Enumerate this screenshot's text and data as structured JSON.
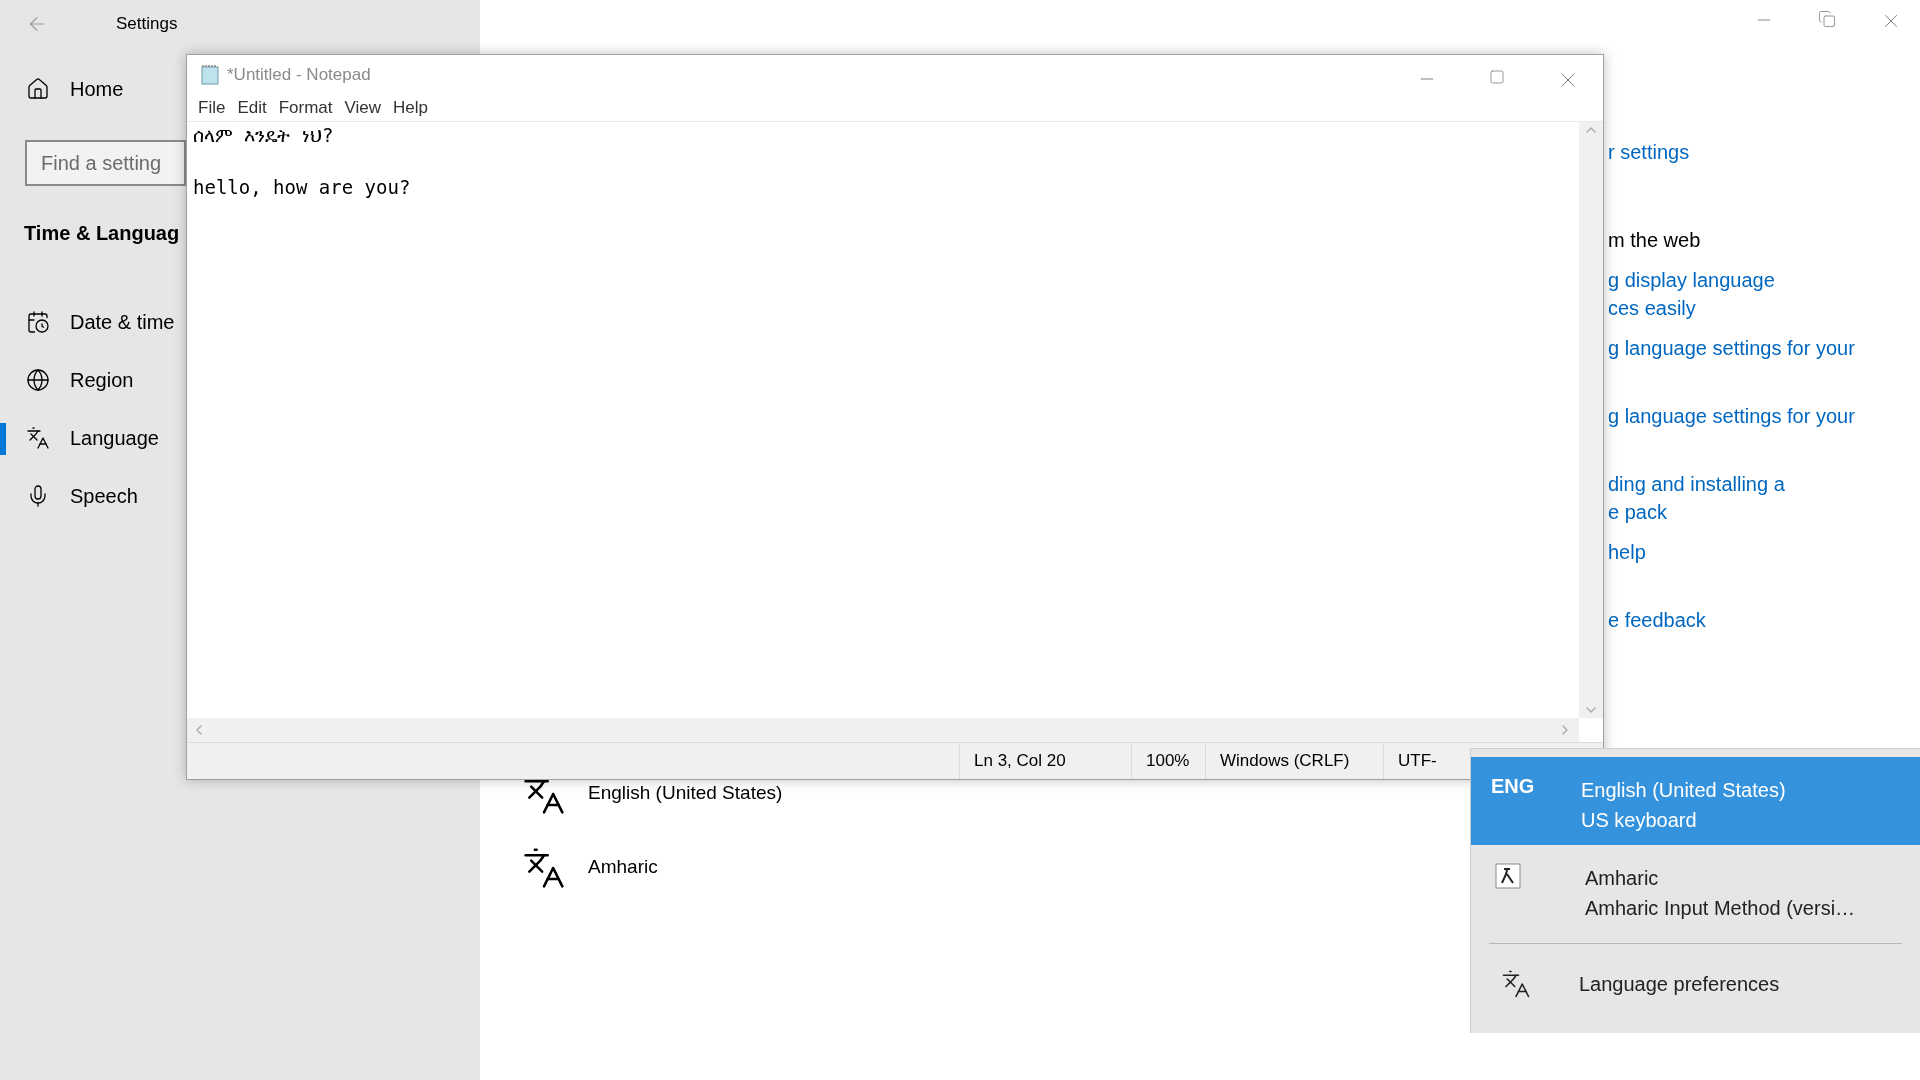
{
  "settings": {
    "title": "Settings",
    "home": "Home",
    "search": {
      "placeholder": "Find a setting"
    },
    "section_title": "Time & Languag",
    "nav": [
      {
        "kind": "date",
        "label": "Date & time",
        "selected": false
      },
      {
        "kind": "region",
        "label": "Region",
        "selected": false
      },
      {
        "kind": "language",
        "label": "Language",
        "selected": true
      },
      {
        "kind": "speech",
        "label": "Speech",
        "selected": false
      }
    ],
    "languages": [
      {
        "name": "English (United States)"
      },
      {
        "name": "Amharic"
      }
    ],
    "related": [
      {
        "kind": "link",
        "lines": [
          "r settings"
        ]
      },
      {
        "kind": "heading",
        "lines": [
          "m the web"
        ]
      },
      {
        "kind": "link",
        "lines": [
          "g display language",
          "ces easily"
        ]
      },
      {
        "kind": "link",
        "lines": [
          "g language settings for your"
        ]
      },
      {
        "kind": "link",
        "lines": [
          "g language settings for your"
        ]
      },
      {
        "kind": "link",
        "lines": [
          "ding and installing a",
          "e pack"
        ]
      },
      {
        "kind": "link",
        "lines": [
          "help"
        ]
      },
      {
        "kind": "link",
        "lines": [
          "e feedback"
        ]
      }
    ]
  },
  "notepad": {
    "title": "*Untitled - Notepad",
    "menu": [
      "File",
      "Edit",
      "Format",
      "View",
      "Help"
    ],
    "lines": [
      "ሰላም እንዴት ነህ?",
      "hello, how are you?"
    ],
    "status": [
      "Ln 3, Col 20",
      "100%",
      "Windows (CRLF)",
      "UTF-"
    ]
  },
  "flyout": {
    "items": [
      {
        "kind": "layout",
        "code": "ENG",
        "name": "English (United States)",
        "layout": "US keyboard",
        "selected": true
      },
      {
        "kind": "layout",
        "name": "Amharic",
        "layout": "Amharic Input Method (versi…",
        "selected": false
      },
      {
        "kind": "preferences",
        "label": "Language preferences"
      }
    ]
  }
}
